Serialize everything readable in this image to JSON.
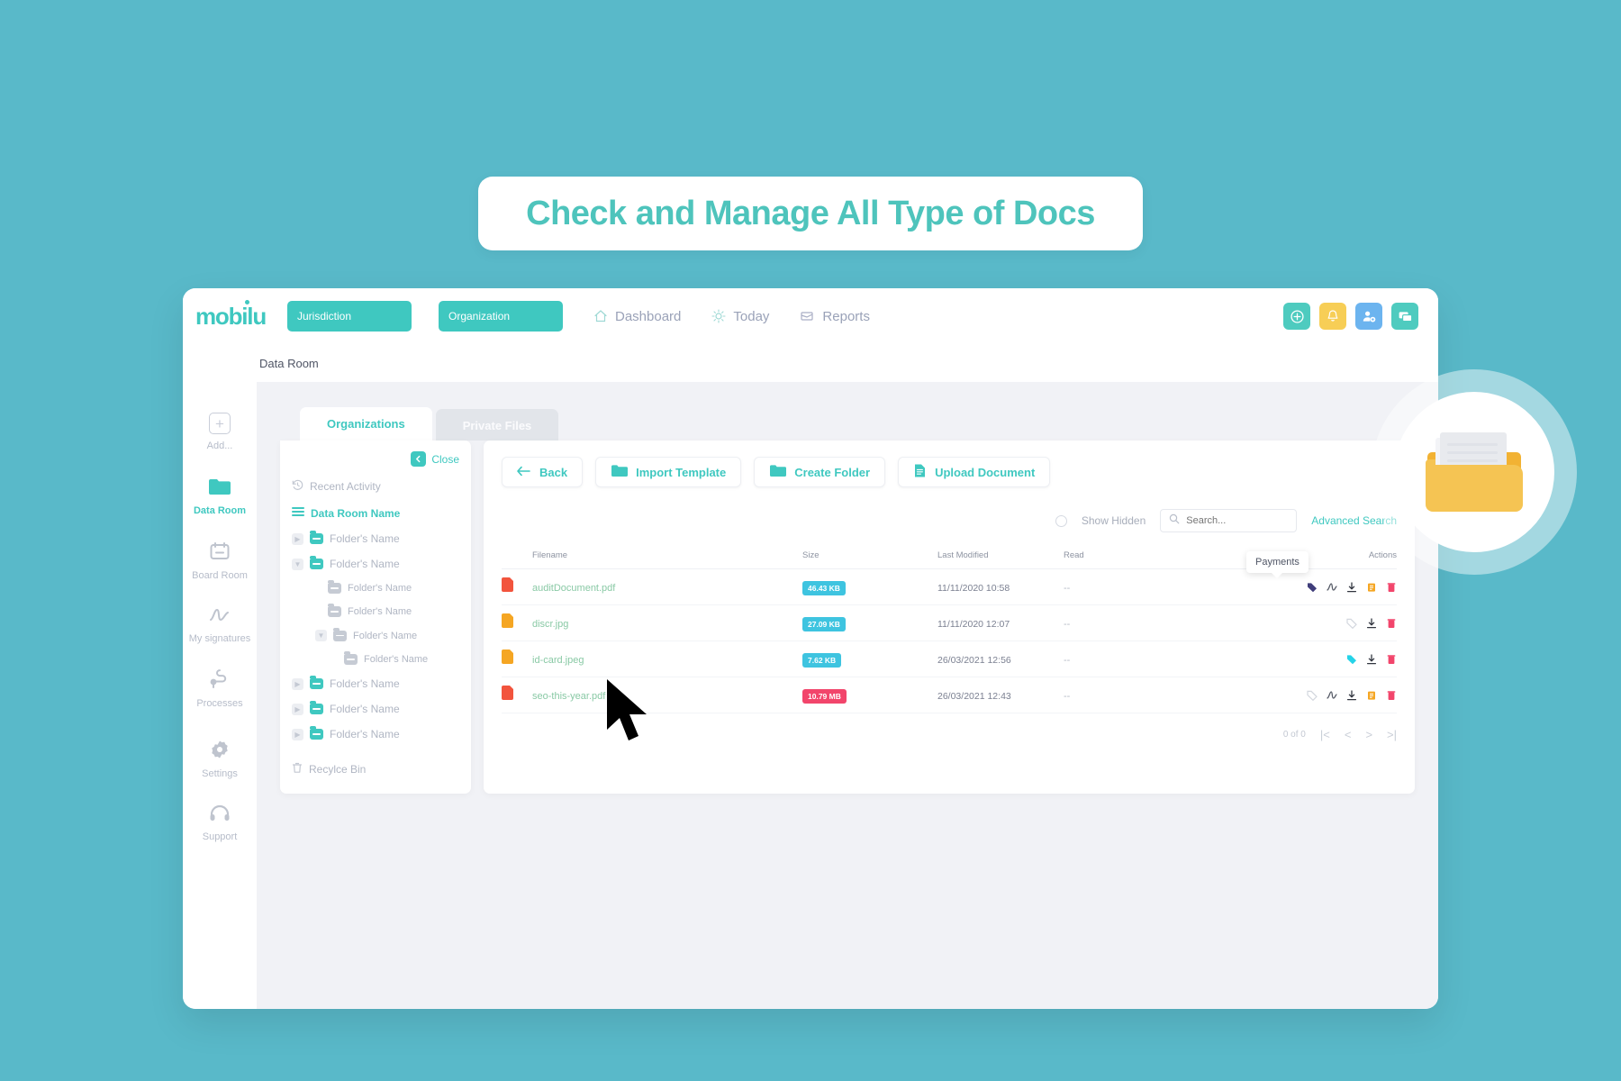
{
  "headline": {
    "text": "Check and Manage All Type of Docs"
  },
  "brand": {
    "logo": "mobilu",
    "accent": "#3fc8c0"
  },
  "topbar": {
    "pills": [
      {
        "label": "Jurisdiction"
      },
      {
        "label": "Organization"
      }
    ],
    "nav": [
      {
        "label": "Dashboard",
        "icon": "home-icon"
      },
      {
        "label": "Today",
        "icon": "sun-icon"
      },
      {
        "label": "Reports",
        "icon": "reports-icon"
      }
    ],
    "actions": [
      {
        "name": "add-button",
        "icon": "plus-circle-icon",
        "color": "#4ecbbf"
      },
      {
        "name": "notifications-button",
        "icon": "bell-icon",
        "color": "#f7ce56"
      },
      {
        "name": "user-settings-button",
        "icon": "user-gear-icon",
        "color": "#6cb4ef"
      },
      {
        "name": "messages-button",
        "icon": "chat-icon",
        "color": "#4ecbbf"
      }
    ]
  },
  "breadcrumb": {
    "label": "Data Room"
  },
  "sidebar": {
    "items": [
      {
        "label": "Add...",
        "icon": "plus-square-icon",
        "active": false
      },
      {
        "label": "Data Room",
        "icon": "folder-icon",
        "active": true
      },
      {
        "label": "Board Room",
        "icon": "board-icon",
        "active": false
      },
      {
        "label": "My signatures",
        "icon": "signature-icon",
        "active": false
      },
      {
        "label": "Processes",
        "icon": "process-icon",
        "active": false
      },
      {
        "label": "Settings",
        "icon": "gear-icon",
        "active": false
      },
      {
        "label": "Support",
        "icon": "headset-icon",
        "active": false
      }
    ]
  },
  "tabs": [
    {
      "label": "Organizations",
      "active": true
    },
    {
      "label": "Private Files",
      "active": false
    }
  ],
  "tree": {
    "close_label": "Close",
    "nodes": [
      {
        "label": "Recent Activity",
        "type": "recent",
        "indent": 0,
        "chevron": "none"
      },
      {
        "label": "Data Room Name",
        "type": "root",
        "indent": 0,
        "chevron": "none"
      },
      {
        "label": "Folder's Name",
        "type": "folder",
        "indent": 1,
        "chevron": "right"
      },
      {
        "label": "Folder's Name",
        "type": "folder",
        "indent": 1,
        "chevron": "down"
      },
      {
        "label": "Folder's Name",
        "type": "subfolder",
        "indent": 3,
        "chevron": "none"
      },
      {
        "label": "Folder's Name",
        "type": "subfolder",
        "indent": 3,
        "chevron": "none"
      },
      {
        "label": "Folder's Name",
        "type": "subfolder",
        "indent": 2,
        "chevron": "down"
      },
      {
        "label": "Folder's Name",
        "type": "subfolder",
        "indent": 4,
        "chevron": "none"
      },
      {
        "label": "Folder's Name",
        "type": "folder",
        "indent": 1,
        "chevron": "right"
      },
      {
        "label": "Folder's Name",
        "type": "folder",
        "indent": 1,
        "chevron": "right"
      },
      {
        "label": "Folder's Name",
        "type": "folder",
        "indent": 1,
        "chevron": "right"
      },
      {
        "label": "Recylce Bin",
        "type": "trash",
        "indent": 0,
        "chevron": "none"
      }
    ]
  },
  "toolbar": {
    "back_label": "Back",
    "import_label": "Import Template",
    "create_folder_label": "Create Folder",
    "upload_label": "Upload Document"
  },
  "search": {
    "show_hidden_label": "Show Hidden",
    "placeholder": "Search...",
    "value": "",
    "advanced_label": "Advanced Search"
  },
  "table": {
    "headers": [
      "Filename",
      "Size",
      "Last Modified",
      "Read",
      "Actions"
    ],
    "rows": [
      {
        "filename": "auditDocument.pdf",
        "filetype": "pdf",
        "size": "46.43 KB",
        "size_color": "blue",
        "modified": "11/11/2020 10:58",
        "read": "--",
        "actions": [
          "tag-filled-purple",
          "signature-icon",
          "download-icon",
          "clipboard-icon",
          "delete-icon"
        ]
      },
      {
        "filename": "discr.jpg",
        "filetype": "img",
        "size": "27.09 KB",
        "size_color": "blue",
        "modified": "11/11/2020 12:07",
        "read": "--",
        "actions": [
          "tag-outline-icon",
          "download-icon",
          "delete-icon"
        ]
      },
      {
        "filename": "id-card.jpeg",
        "filetype": "img",
        "size": "7.62 KB",
        "size_color": "blue",
        "modified": "26/03/2021 12:56",
        "read": "--",
        "actions": [
          "tag-filled-cyan",
          "download-icon",
          "delete-icon"
        ]
      },
      {
        "filename": "seo-this-year.pdf",
        "filetype": "pdf",
        "size": "10.79 MB",
        "size_color": "red",
        "modified": "26/03/2021 12:43",
        "read": "--",
        "actions": [
          "tag-outline-icon",
          "signature-icon",
          "download-icon",
          "clipboard-icon",
          "delete-icon"
        ]
      }
    ]
  },
  "pagination": {
    "count_label": "0 of 0"
  },
  "tooltip": {
    "label": "Payments"
  }
}
